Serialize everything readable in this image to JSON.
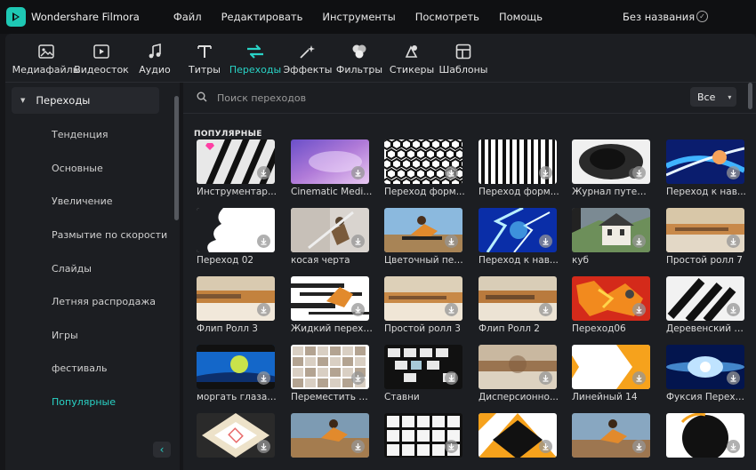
{
  "app": {
    "name": "Wondershare Filmora",
    "menu": [
      "Файл",
      "Редактировать",
      "Инструменты",
      "Посмотреть",
      "Помощь"
    ],
    "project_title": "Без названия"
  },
  "toolbar": {
    "items": [
      {
        "label": "Медиафайлы",
        "icon": "media-icon"
      },
      {
        "label": "Видеосток",
        "icon": "stock-video-icon"
      },
      {
        "label": "Аудио",
        "icon": "music-note-icon"
      },
      {
        "label": "Титры",
        "icon": "titles-icon"
      },
      {
        "label": "Переходы",
        "icon": "transitions-icon",
        "active": true
      },
      {
        "label": "Эффекты",
        "icon": "effects-icon"
      },
      {
        "label": "Фильтры",
        "icon": "filters-icon"
      },
      {
        "label": "Стикеры",
        "icon": "stickers-icon"
      },
      {
        "label": "Шаблоны",
        "icon": "templates-icon"
      }
    ],
    "accent_color": "#29d3c6"
  },
  "sidebar": {
    "header": "Переходы",
    "items": [
      {
        "label": "Тенденция"
      },
      {
        "label": "Основные"
      },
      {
        "label": "Увеличение"
      },
      {
        "label": "Размытие по скорости"
      },
      {
        "label": "Слайды"
      },
      {
        "label": "Летняя распродажа"
      },
      {
        "label": "Игры"
      },
      {
        "label": "фестиваль"
      },
      {
        "label": "Популярные",
        "active": true
      }
    ]
  },
  "search": {
    "placeholder": "Поиск переходов",
    "filter_value": "Все"
  },
  "section": {
    "title": "ПОПУЛЯРНЫЕ"
  },
  "grid": {
    "rows": [
      [
        "Инструментар...",
        "Cinematic Medi...",
        "Переход форм...",
        "Переход форм...",
        "Журнал путеш...",
        "Переход к нав..."
      ],
      [
        "Переход 02",
        "косая черта",
        "Цветочный пер...",
        "Переход к нав...",
        "куб",
        "Простой ролл 7"
      ],
      [
        "Флип Ролл 3",
        "Жидкий перехо...",
        "Простой ролл 3",
        "Флип Ролл 2",
        "Переход06",
        "Деревенский п..."
      ],
      [
        "моргать глазами",
        "Переместить п...",
        "Ставни",
        "Дисперсионно...",
        "Линейный 14",
        "Фуксия Перехо..."
      ],
      [
        "",
        "",
        "",
        "",
        "",
        ""
      ]
    ]
  }
}
